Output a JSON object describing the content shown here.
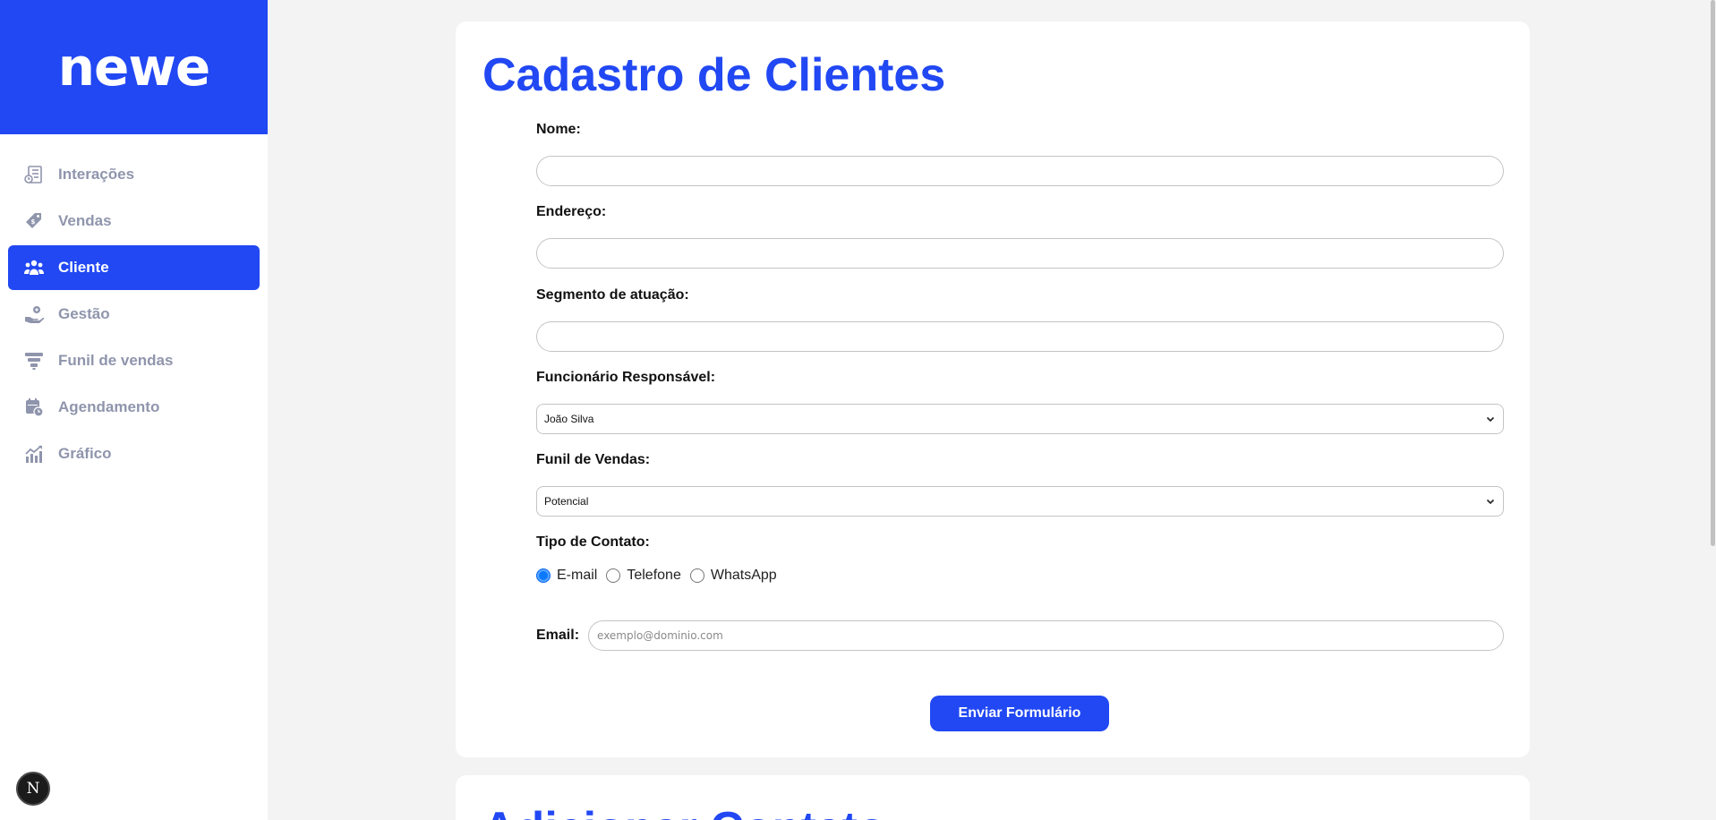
{
  "brand": {
    "logo_text": "newe",
    "color": "#2148f3"
  },
  "sidebar": {
    "items": [
      {
        "label": "Interações",
        "icon": "checklist-timer-icon",
        "active": false
      },
      {
        "label": "Vendas",
        "icon": "price-tag-icon",
        "active": false
      },
      {
        "label": "Cliente",
        "icon": "users-icon",
        "active": true
      },
      {
        "label": "Gestão",
        "icon": "hand-gear-icon",
        "active": false
      },
      {
        "label": "Funil de vendas",
        "icon": "funnel-icon",
        "active": false
      },
      {
        "label": "Agendamento",
        "icon": "calendar-clock-icon",
        "active": false
      },
      {
        "label": "Gráfico",
        "icon": "chart-line-icon",
        "active": false
      }
    ]
  },
  "badge": {
    "text": "N",
    "icon": "nextjs-icon"
  },
  "form": {
    "title": "Cadastro de Clientes",
    "fields": {
      "nome": {
        "label": "Nome:",
        "value": ""
      },
      "endereco": {
        "label": "Endereço:",
        "value": ""
      },
      "segmento": {
        "label": "Segmento de atuação:",
        "value": ""
      },
      "funcionario": {
        "label": "Funcionário Responsável:",
        "selected": "João Silva"
      },
      "funil": {
        "label": "Funil de Vendas:",
        "selected": "Potencial"
      },
      "tipo_contato": {
        "label": "Tipo de Contato:",
        "options": [
          "E-mail",
          "Telefone",
          "WhatsApp"
        ],
        "selected": "E-mail"
      },
      "email": {
        "label": "Email:",
        "placeholder": "exemplo@dominio.com",
        "value": ""
      }
    },
    "submit_label": "Enviar Formulário"
  },
  "second_card": {
    "title": "Adicionar Contato"
  }
}
